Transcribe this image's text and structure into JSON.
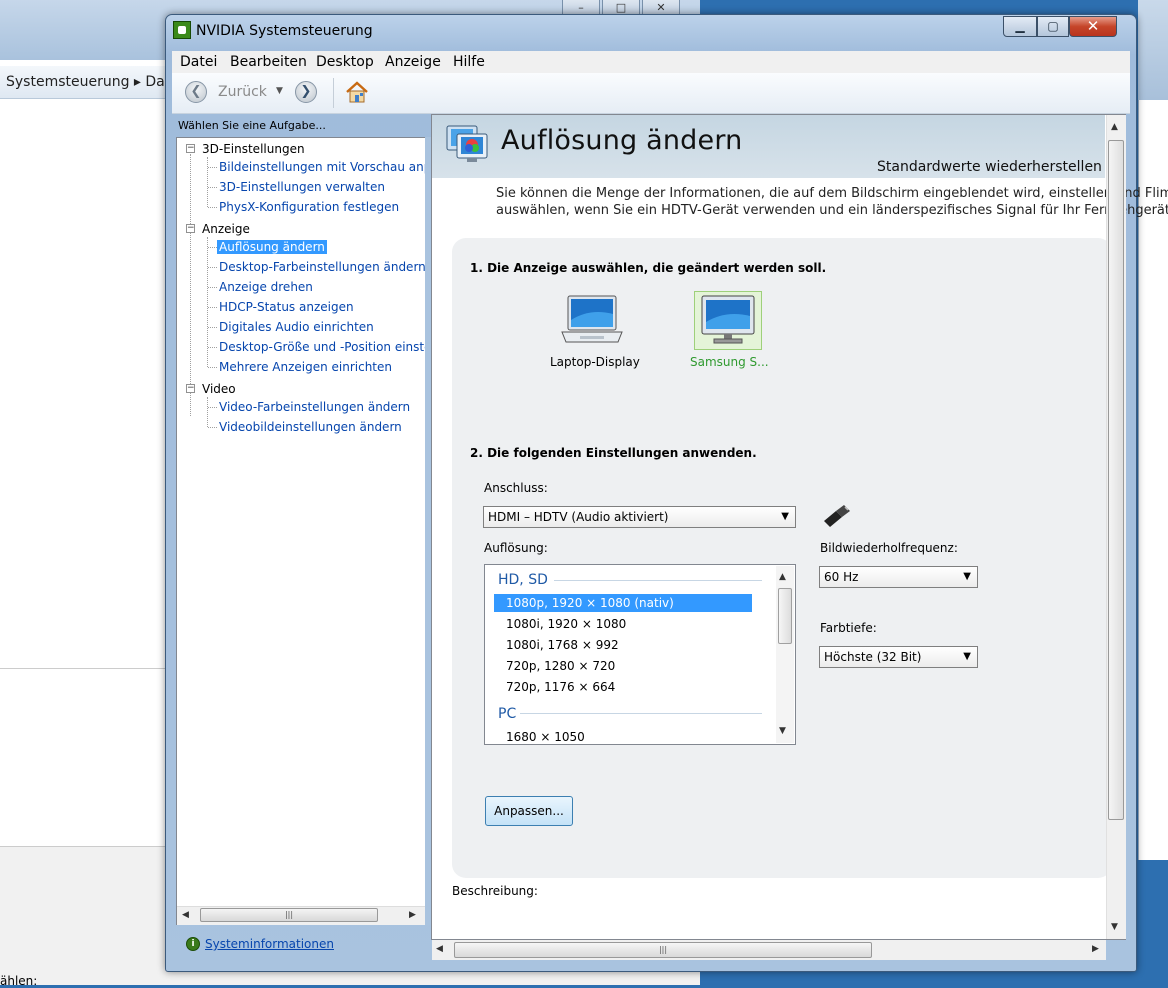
{
  "background": {
    "address_text": "Systemsteuerung ▸ Da",
    "bottom_text": "ählen:"
  },
  "window": {
    "title": "NVIDIA Systemsteuerung",
    "caption_buttons": [
      "minimize-button",
      "maximize-button",
      "close-button"
    ]
  },
  "menu": [
    "Datei",
    "Bearbeiten",
    "Desktop",
    "Anzeige",
    "Hilfe"
  ],
  "toolbar": {
    "back_label": "Zurück"
  },
  "left_panel": {
    "task_label": "Wählen Sie eine Aufgabe...",
    "categories": [
      {
        "label": "3D-Einstellungen",
        "items": [
          "Bildeinstellungen mit Vorschau anpassen",
          "3D-Einstellungen verwalten",
          "PhysX-Konfiguration festlegen"
        ]
      },
      {
        "label": "Anzeige",
        "items": [
          "Auflösung ändern",
          "Desktop-Farbeinstellungen ändern",
          "Anzeige drehen",
          "HDCP-Status anzeigen",
          "Digitales Audio einrichten",
          "Desktop-Größe und -Position einstellen",
          "Mehrere Anzeigen einrichten"
        ]
      },
      {
        "label": "Video",
        "items": [
          "Video-Farbeinstellungen ändern",
          "Videobildeinstellungen ändern"
        ]
      }
    ],
    "selected_item": "Auflösung ändern",
    "system_info": "Systeminformationen"
  },
  "content": {
    "title": "Auflösung ändern",
    "restore_defaults": "Standardwerte wiederherstellen",
    "intro_line1": "Sie können die Menge der Informationen, die auf dem Bildschirm eingeblendet wird, einstellen und Flimr",
    "intro_line2": "auswählen, wenn Sie ein HDTV-Gerät verwenden und ein länderspezifisches Signal für Ihr Fernsehgerät",
    "step1": "1. Die Anzeige auswählen, die geändert werden soll.",
    "displays": [
      {
        "label": "Laptop-Display",
        "selected": false
      },
      {
        "label": "Samsung S...",
        "selected": true
      }
    ],
    "step2": "2. Die folgenden Einstellungen anwenden.",
    "connection_label": "Anschluss:",
    "connection_value": "HDMI – HDTV (Audio aktiviert)",
    "resolution_label": "Auflösung:",
    "resolution_groups": [
      {
        "name": "HD, SD",
        "items": [
          "1080p, 1920 × 1080 (nativ)",
          "1080i, 1920 × 1080",
          "1080i, 1768 × 992",
          "720p, 1280 × 720",
          "720p, 1176 × 664"
        ]
      },
      {
        "name": "PC",
        "items": [
          "1680 × 1050"
        ]
      }
    ],
    "selected_resolution": "1080p, 1920 × 1080 (nativ)",
    "refresh_label": "Bildwiederholfrequenz:",
    "refresh_value": "60 Hz",
    "color_depth_label": "Farbtiefe:",
    "color_depth_value": "Höchste (32 Bit)",
    "adjust_button": "Anpassen...",
    "description_label": "Beschreibung:"
  },
  "colors": {
    "link": "#0645ad",
    "selection": "#3399ff",
    "group_header": "#1f5aa6",
    "selected_display": "#2f9a2f"
  },
  "icons": [
    "back-arrow-icon",
    "forward-arrow-icon",
    "home-icon",
    "nvidia-icon",
    "monitor-icon",
    "laptop-icon",
    "hdmi-connector-icon",
    "system-info-icon"
  ]
}
